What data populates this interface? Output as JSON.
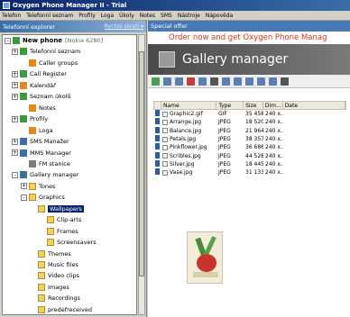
{
  "window": {
    "title": "Oxygen Phone Manager II - Trial"
  },
  "menu": [
    "Telefon",
    "Telefonní seznam",
    "Profily",
    "Loga",
    "Úkoly",
    "Notes",
    "SMS",
    "Nástroje",
    "Nápověda"
  ],
  "left_panel": {
    "title": "Telefonní explorer",
    "link": "Rychlé skryti ▾"
  },
  "tree": [
    {
      "label": "New phone",
      "note": "[Nokia 6280]",
      "bold": true,
      "icon": "phone-icon",
      "exp": "-"
    },
    {
      "label": "Telefonní seznam",
      "icon": "phonebook-icon",
      "exp": "+"
    },
    {
      "label": "Caller groups",
      "icon": "caller-groups-icon"
    },
    {
      "label": "Call Register",
      "icon": "call-register-icon",
      "exp": "+"
    },
    {
      "label": "Kalendář",
      "icon": "calendar-icon",
      "exp": "+"
    },
    {
      "label": "Seznam úkolů",
      "icon": "tasks-icon",
      "exp": "+"
    },
    {
      "label": "Notes",
      "icon": "notes-icon"
    },
    {
      "label": "Profily",
      "icon": "profiles-icon",
      "exp": "+"
    },
    {
      "label": "Loga",
      "icon": "logos-icon"
    },
    {
      "label": "SMS Manažer",
      "icon": "sms-icon",
      "exp": "+"
    },
    {
      "label": "MMS Manager",
      "icon": "mms-icon",
      "exp": "+"
    },
    {
      "label": "FM stanice",
      "icon": "fm-icon"
    },
    {
      "label": "Gallery manager",
      "icon": "gallery-icon",
      "exp": "-"
    },
    {
      "label": "Tones",
      "icon": "folder-icon",
      "exp": "+"
    },
    {
      "label": "Graphics",
      "icon": "folder-icon",
      "exp": "-"
    },
    {
      "label": "Wallpapers",
      "icon": "folder-icon",
      "selected": true
    },
    {
      "label": "Clip-arts",
      "icon": "folder-icon"
    },
    {
      "label": "Frames",
      "icon": "folder-icon"
    },
    {
      "label": "Screensavers",
      "icon": "folder-icon"
    },
    {
      "label": "Themes",
      "icon": "folder-icon"
    },
    {
      "label": "Music files",
      "icon": "folder-icon"
    },
    {
      "label": "Video clips",
      "icon": "folder-icon"
    },
    {
      "label": "Images",
      "icon": "folder-icon"
    },
    {
      "label": "Recordings",
      "icon": "folder-icon"
    },
    {
      "label": "predefreceived",
      "icon": "folder-icon"
    }
  ],
  "right_panel": {
    "offer_bar": "Special offer",
    "promo": "Order now and get Oxygen Phone Manag",
    "banner_title": "Gallery manager"
  },
  "table": {
    "columns": [
      "",
      "Name",
      "Type",
      "Size",
      "Dim...",
      "Date"
    ],
    "rows": [
      {
        "name": "Graphic2.gif",
        "type": "GIF",
        "size": "35 458",
        "dim": "240 x..."
      },
      {
        "name": "Arrange.jpg",
        "type": "JPEG",
        "size": "18 520",
        "dim": "240 x..."
      },
      {
        "name": "Balance.jpg",
        "type": "JPEG",
        "size": "21 964",
        "dim": "240 x..."
      },
      {
        "name": "Petals.jpg",
        "type": "JPEG",
        "size": "38 357",
        "dim": "240 x..."
      },
      {
        "name": "Pinkflower.jpg",
        "type": "JPEG",
        "size": "36 686",
        "dim": "240 x..."
      },
      {
        "name": "Scribles.jpg",
        "type": "JPEG",
        "size": "44 528",
        "dim": "240 x..."
      },
      {
        "name": "Silver.jpg",
        "type": "JPEG",
        "size": "18 445",
        "dim": "240 x..."
      },
      {
        "name": "Vase.jpg",
        "type": "JPEG",
        "size": "31 133",
        "dim": "240 x..."
      }
    ]
  }
}
